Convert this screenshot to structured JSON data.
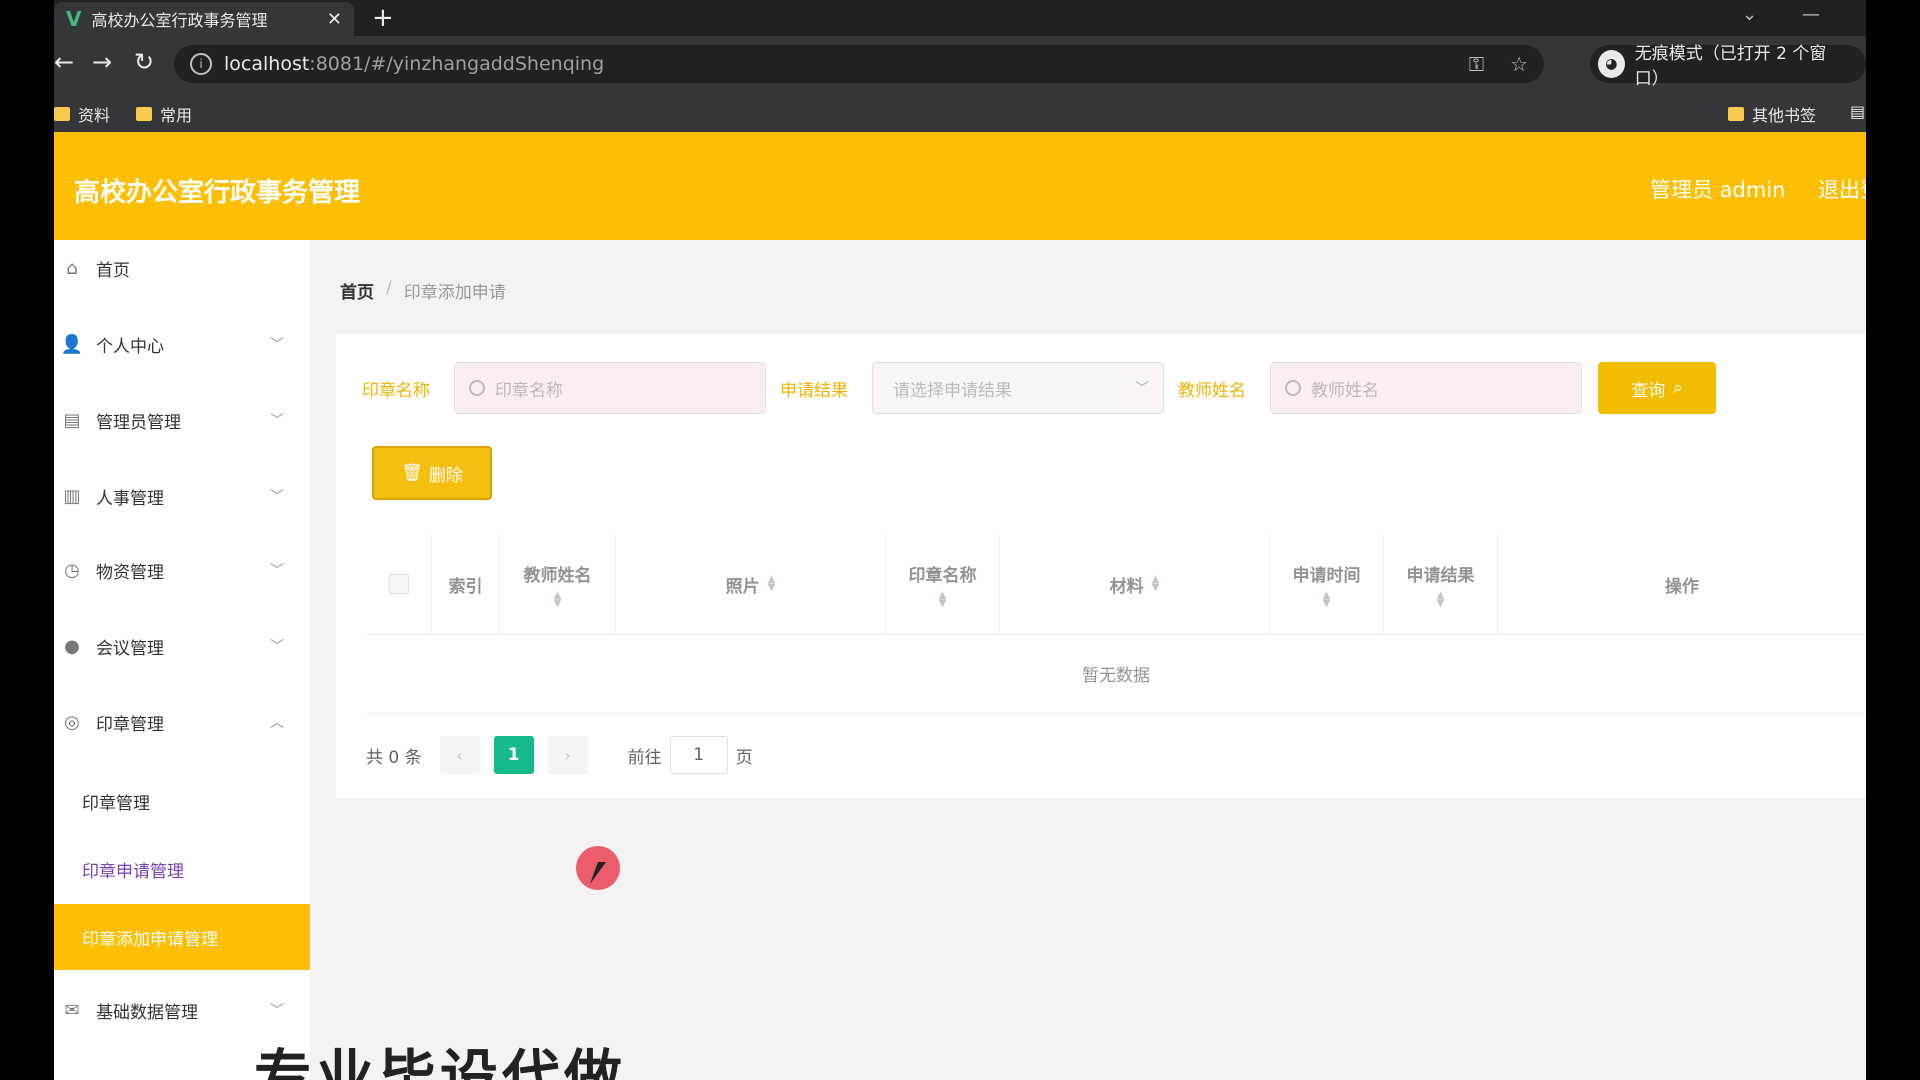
{
  "browser": {
    "tab_title": "高校办公室行政事务管理",
    "tab_close": "✕",
    "new_tab": "+",
    "url_host": "localhost",
    "url_path": ":8081/#/yinzhangaddShenqing",
    "incognito_label": "无痕模式（已打开 2 个窗口）",
    "bookmarks": [
      "资料",
      "常用"
    ],
    "other_bookmarks": "其他书签"
  },
  "header": {
    "title": "高校办公室行政事务管理",
    "user": "管理员 admin",
    "logout": "退出登录"
  },
  "sidebar": {
    "items": [
      {
        "label": "首页",
        "icon": "home-icon"
      },
      {
        "label": "个人中心",
        "icon": "user-icon"
      },
      {
        "label": "管理员管理",
        "icon": "card-icon"
      },
      {
        "label": "人事管理",
        "icon": "book-icon"
      },
      {
        "label": "物资管理",
        "icon": "compass-icon"
      },
      {
        "label": "会议管理",
        "icon": "bulb-icon"
      },
      {
        "label": "印章管理",
        "icon": "stamp-icon"
      }
    ],
    "sub_items": [
      "印章管理",
      "印章申请管理",
      "印章添加申请管理"
    ],
    "last_item": {
      "label": "基础数据管理",
      "icon": "mail-icon"
    }
  },
  "breadcrumb": {
    "home": "首页",
    "separator": "/",
    "current": "印章添加申请"
  },
  "filters": {
    "seal_name_label": "印章名称",
    "seal_name_placeholder": "印章名称",
    "result_label": "申请结果",
    "result_placeholder": "请选择申请结果",
    "teacher_label": "教师姓名",
    "teacher_placeholder": "教师姓名",
    "query_button": "查询"
  },
  "actions": {
    "delete_button": "删除"
  },
  "table": {
    "columns": [
      "索引",
      "教师姓名",
      "照片",
      "印章名称",
      "材料",
      "申请时间",
      "申请结果",
      "操作"
    ],
    "empty_text": "暂无数据"
  },
  "pagination": {
    "total": "共 0 条",
    "current_page": "1",
    "goto_label": "前往",
    "goto_value": "1",
    "page_suffix": "页"
  },
  "watermark": "专业毕设代做",
  "colors": {
    "accent": "#fdbf03",
    "page_active": "#16b98a"
  }
}
